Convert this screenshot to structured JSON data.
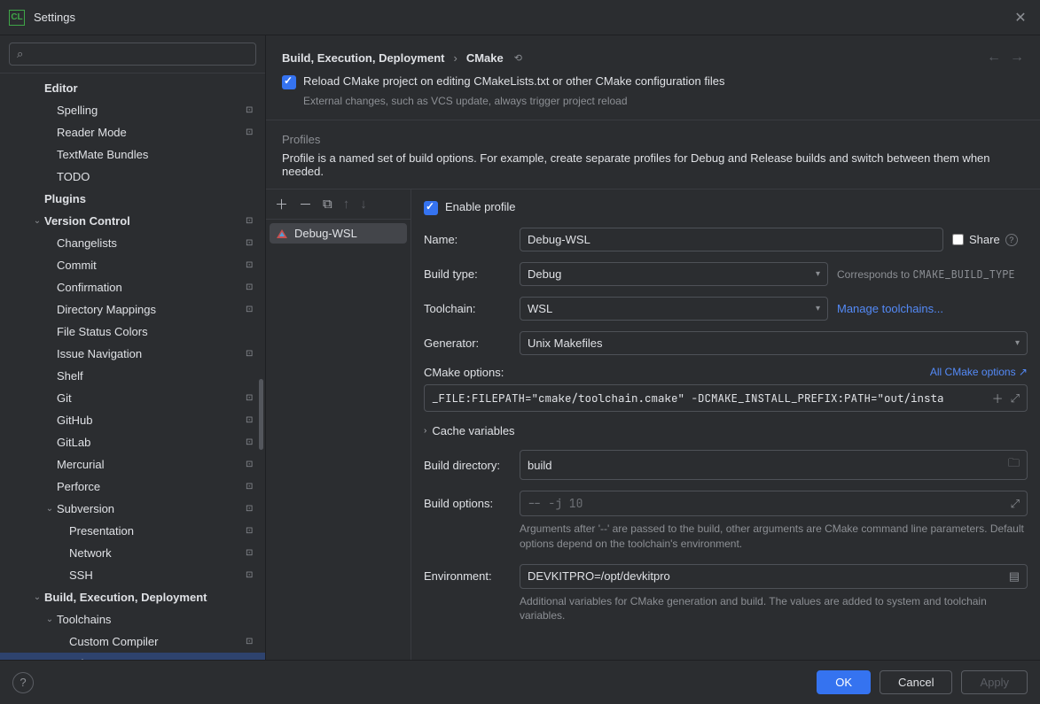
{
  "window": {
    "title": "Settings"
  },
  "sidebar": {
    "search": {
      "placeholder": ""
    },
    "items": [
      {
        "label": "Editor",
        "indent": 2,
        "bold": true,
        "chev": "",
        "mod": false
      },
      {
        "label": "Spelling",
        "indent": 3,
        "mod": true
      },
      {
        "label": "Reader Mode",
        "indent": 3,
        "mod": true
      },
      {
        "label": "TextMate Bundles",
        "indent": 3
      },
      {
        "label": "TODO",
        "indent": 3
      },
      {
        "label": "Plugins",
        "indent": 2,
        "bold": true
      },
      {
        "label": "Version Control",
        "indent": 2,
        "bold": true,
        "chev": "down",
        "mod": true
      },
      {
        "label": "Changelists",
        "indent": 3,
        "mod": true
      },
      {
        "label": "Commit",
        "indent": 3,
        "mod": true
      },
      {
        "label": "Confirmation",
        "indent": 3,
        "mod": true
      },
      {
        "label": "Directory Mappings",
        "indent": 3,
        "mod": true
      },
      {
        "label": "File Status Colors",
        "indent": 3
      },
      {
        "label": "Issue Navigation",
        "indent": 3,
        "mod": true
      },
      {
        "label": "Shelf",
        "indent": 3
      },
      {
        "label": "Git",
        "indent": 3,
        "mod": true
      },
      {
        "label": "GitHub",
        "indent": 3,
        "mod": true
      },
      {
        "label": "GitLab",
        "indent": 3,
        "mod": true
      },
      {
        "label": "Mercurial",
        "indent": 3,
        "mod": true
      },
      {
        "label": "Perforce",
        "indent": 3,
        "mod": true
      },
      {
        "label": "Subversion",
        "indent": 3,
        "chev": "down",
        "mod": true
      },
      {
        "label": "Presentation",
        "indent": 4,
        "mod": true
      },
      {
        "label": "Network",
        "indent": 4,
        "mod": true
      },
      {
        "label": "SSH",
        "indent": 4,
        "mod": true
      },
      {
        "label": "Build, Execution, Deployment",
        "indent": 2,
        "bold": true,
        "chev": "down"
      },
      {
        "label": "Toolchains",
        "indent": 3,
        "chev": "down"
      },
      {
        "label": "Custom Compiler",
        "indent": 4,
        "mod": true
      },
      {
        "label": "CMake",
        "indent": 3,
        "mod": true,
        "selected": true
      }
    ]
  },
  "breadcrumb": {
    "a": "Build, Execution, Deployment",
    "b": "CMake"
  },
  "reload": {
    "label": "Reload CMake project on editing CMakeLists.txt or other CMake configuration files",
    "hint": "External changes, such as VCS update, always trigger project reload"
  },
  "profiles": {
    "header": "Profiles",
    "desc": "Profile is a named set of build options. For example, create separate profiles for Debug and Release builds and switch between them when needed.",
    "selected": "Debug-WSL",
    "enable_label": "Enable profile",
    "form": {
      "name_label": "Name:",
      "name_value": "Debug-WSL",
      "share_label": "Share",
      "buildtype_label": "Build type:",
      "buildtype_value": "Debug",
      "buildtype_hint_prefix": "Corresponds to ",
      "buildtype_hint_code": "CMAKE_BUILD_TYPE",
      "toolchain_label": "Toolchain:",
      "toolchain_value": "WSL",
      "manage_link": "Manage toolchains...",
      "generator_label": "Generator:",
      "generator_value": "Unix Makefiles",
      "cmakeopts_label": "CMake options:",
      "allopts_link": "All CMake options ↗",
      "cmakeopts_value": "_FILE:FILEPATH=\"cmake/toolchain.cmake\" -DCMAKE_INSTALL_PREFIX:PATH=\"out/insta",
      "cache_label": "Cache variables",
      "builddir_label": "Build directory:",
      "builddir_value": "build",
      "buildopts_label": "Build options:",
      "buildopts_placeholder": "-- -j 10",
      "buildopts_hint": "Arguments after '--' are passed to the build, other arguments are CMake command line parameters. Default options depend on the toolchain's environment.",
      "env_label": "Environment:",
      "env_value": "DEVKITPRO=/opt/devkitpro",
      "env_hint": "Additional variables for CMake generation and build. The values are added to system and toolchain variables."
    }
  },
  "footer": {
    "ok": "OK",
    "cancel": "Cancel",
    "apply": "Apply"
  }
}
